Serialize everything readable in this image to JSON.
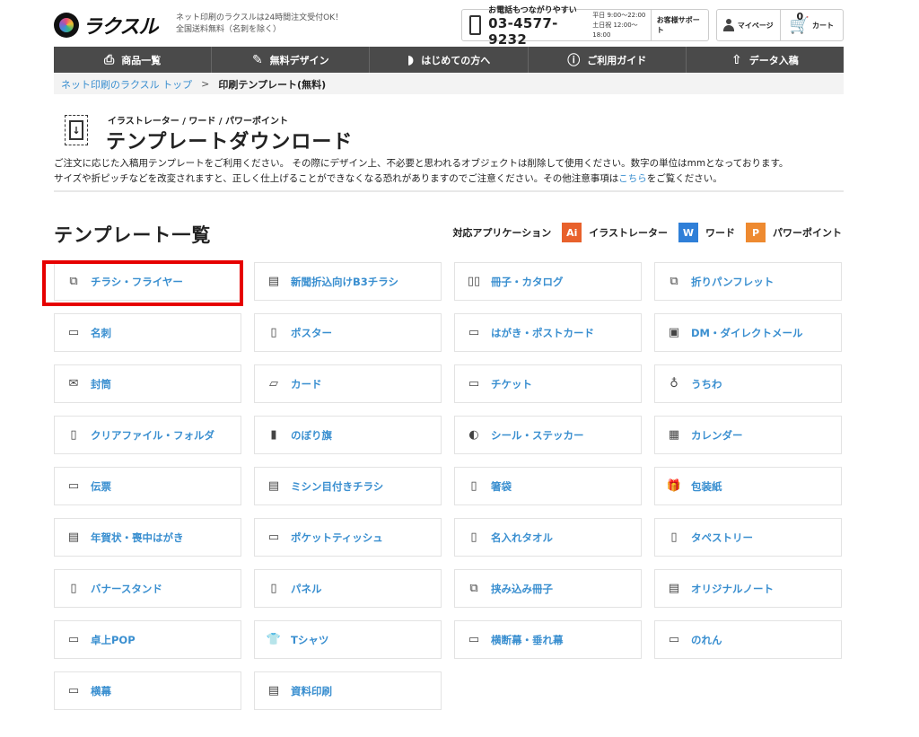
{
  "header": {
    "logo_text": "ラクスル",
    "tagline_1": "ネット印刷のラクスルは24時間注文受付OK！",
    "tagline_2": "全国送料無料（名刺を除く）",
    "phone_label": "お電話もつながりやすい",
    "phone_number": "03-4577-9232",
    "hours_weekday": "平日 9:00〜22:00",
    "hours_weekend": "土日祝 12:00〜18:00",
    "support_label": "お客様サポート",
    "mypage_label": "マイページ",
    "cart_label": "カート",
    "cart_count": "0"
  },
  "nav": {
    "items": [
      {
        "label": "商品一覧",
        "icon": "printer-icon"
      },
      {
        "label": "無料デザイン",
        "icon": "pen-icon"
      },
      {
        "label": "はじめての方へ",
        "icon": "beginner-icon"
      },
      {
        "label": "ご利用ガイド",
        "icon": "help-icon"
      },
      {
        "label": "データ入稿",
        "icon": "upload-icon"
      }
    ]
  },
  "breadcrumb": {
    "home": "ネット印刷のラクスル トップ",
    "separator": ">",
    "current": "印刷テンプレート(無料)"
  },
  "page": {
    "subtitle": "イラストレーター / ワード / パワーポイント",
    "title": "テンプレートダウンロード",
    "desc_line1": "ご注文に応じた入稿用テンプレートをご利用ください。 その際にデザイン上、不必要と思われるオブジェクトは削除して使用ください。数字の単位はmmとなっております。",
    "desc_line2_pre": "サイズや折ピッチなどを改変されますと、正しく仕上げることができなくなる恐れがありますのでご注意ください。その他注意事項は",
    "desc_link": "こちら",
    "desc_line2_post": "をご覧ください。"
  },
  "list": {
    "title": "テンプレート一覧",
    "apps_label": "対応アプリケーション",
    "apps": [
      {
        "badge": "Ai",
        "name": "イラストレーター",
        "color": "#e8612c"
      },
      {
        "badge": "W",
        "name": "ワード",
        "color": "#2f7fd8"
      },
      {
        "badge": "P",
        "name": "パワーポイント",
        "color": "#ee8a30"
      }
    ],
    "items": [
      {
        "label": "チラシ・フライヤー",
        "icon": "flyer-icon",
        "glyph": "⧉"
      },
      {
        "label": "新聞折込向けB3チラシ",
        "icon": "newspaper-icon",
        "glyph": "▤"
      },
      {
        "label": "冊子・カタログ",
        "icon": "book-icon",
        "glyph": "▯▯"
      },
      {
        "label": "折りパンフレット",
        "icon": "pamphlet-icon",
        "glyph": "⧉"
      },
      {
        "label": "名刺",
        "icon": "business-card-icon",
        "glyph": "▭"
      },
      {
        "label": "ポスター",
        "icon": "poster-icon",
        "glyph": "▯"
      },
      {
        "label": "はがき・ポストカード",
        "icon": "postcard-icon",
        "glyph": "▭"
      },
      {
        "label": "DM・ダイレクトメール",
        "icon": "direct-mail-icon",
        "glyph": "▣"
      },
      {
        "label": "封筒",
        "icon": "envelope-icon",
        "glyph": "✉"
      },
      {
        "label": "カード",
        "icon": "card-icon",
        "glyph": "▱"
      },
      {
        "label": "チケット",
        "icon": "ticket-icon",
        "glyph": "▭"
      },
      {
        "label": "うちわ",
        "icon": "fan-icon",
        "glyph": "♁"
      },
      {
        "label": "クリアファイル・フォルダ",
        "icon": "clear-file-icon",
        "glyph": "▯"
      },
      {
        "label": "のぼり旗",
        "icon": "banner-flag-icon",
        "glyph": "▮"
      },
      {
        "label": "シール・ステッカー",
        "icon": "sticker-icon",
        "glyph": "◐"
      },
      {
        "label": "カレンダー",
        "icon": "calendar-icon",
        "glyph": "▦"
      },
      {
        "label": "伝票",
        "icon": "slip-icon",
        "glyph": "▭"
      },
      {
        "label": "ミシン目付きチラシ",
        "icon": "perforated-flyer-icon",
        "glyph": "▤"
      },
      {
        "label": "箸袋",
        "icon": "chopstick-bag-icon",
        "glyph": "▯"
      },
      {
        "label": "包装紙",
        "icon": "gift-icon",
        "glyph": "🎁"
      },
      {
        "label": "年賀状・喪中はがき",
        "icon": "new-year-card-icon",
        "glyph": "▤"
      },
      {
        "label": "ポケットティッシュ",
        "icon": "tissue-icon",
        "glyph": "▭"
      },
      {
        "label": "名入れタオル",
        "icon": "towel-icon",
        "glyph": "▯"
      },
      {
        "label": "タペストリー",
        "icon": "tapestry-icon",
        "glyph": "▯"
      },
      {
        "label": "バナースタンド",
        "icon": "banner-stand-icon",
        "glyph": "▯"
      },
      {
        "label": "パネル",
        "icon": "panel-icon",
        "glyph": "▯"
      },
      {
        "label": "挟み込み冊子",
        "icon": "insert-booklet-icon",
        "glyph": "⧉"
      },
      {
        "label": "オリジナルノート",
        "icon": "notebook-icon",
        "glyph": "▤"
      },
      {
        "label": "卓上POP",
        "icon": "table-pop-icon",
        "glyph": "▭"
      },
      {
        "label": "Tシャツ",
        "icon": "tshirt-icon",
        "glyph": "👕"
      },
      {
        "label": "横断幕・垂れ幕",
        "icon": "horizontal-banner-icon",
        "glyph": "▭"
      },
      {
        "label": "のれん",
        "icon": "noren-icon",
        "glyph": "▭"
      },
      {
        "label": "横幕",
        "icon": "side-banner-icon",
        "glyph": "▭"
      },
      {
        "label": "資料印刷",
        "icon": "document-print-icon",
        "glyph": "▤"
      }
    ]
  }
}
